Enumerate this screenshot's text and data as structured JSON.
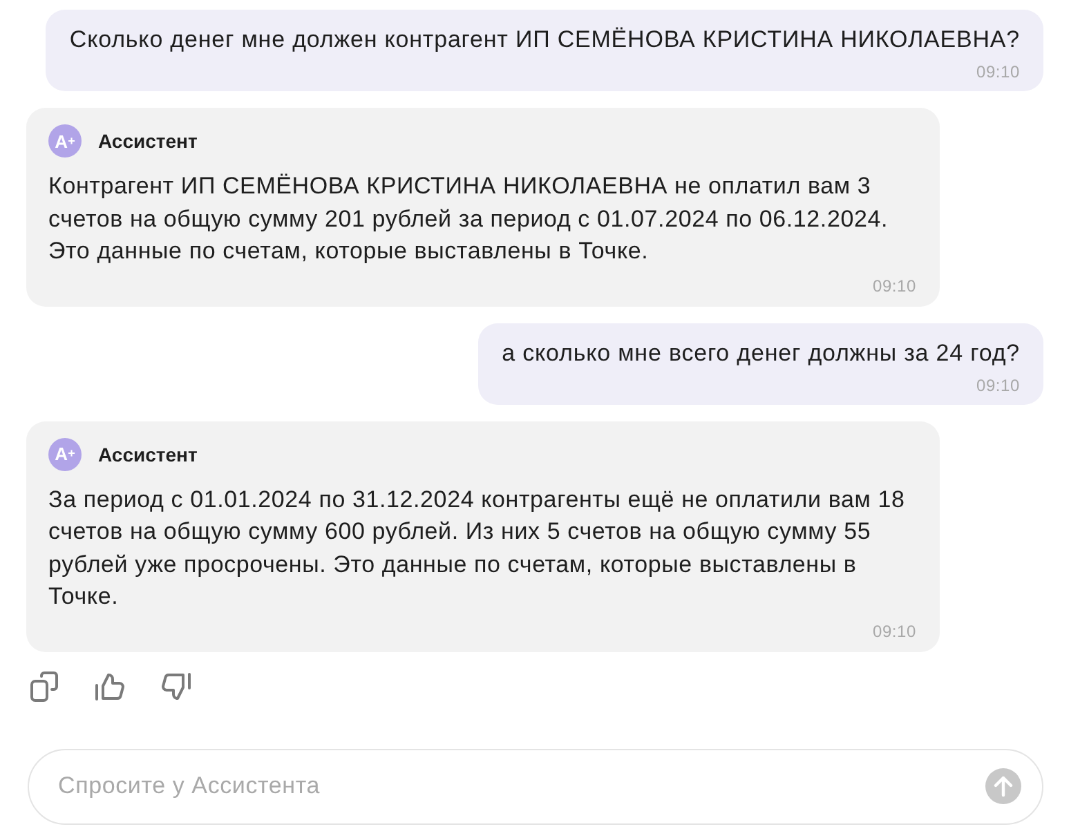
{
  "messages": [
    {
      "kind": "user",
      "text": "Сколько денег мне должен контрагент ИП СЕМЁНОВА КРИСТИНА НИКОЛАЕВНА?",
      "time": "09:10"
    },
    {
      "kind": "assistant",
      "avatar": "A$^{+}$",
      "author": "Ассистент",
      "text": "Контрагент ИП СЕМЁНОВА КРИСТИНА НИКОЛАЕВНА не оплатил вам 3 счетов на общую сумму 201 рублей за период с 01.07.2024 по 06.12.2024. Это данные по счетам, которые выставлены в Точке.",
      "time": "09:10"
    },
    {
      "kind": "user",
      "text": "а сколько мне всего денег должны за 24 год?",
      "time": "09:10"
    },
    {
      "kind": "assistant",
      "avatar": "A$^{+}$",
      "author": "Ассистент",
      "text": "За период с 01.01.2024 по 31.12.2024 контрагенты ещё не оплатили вам 18 счетов на общую сумму 600 рублей. Из них 5 счетов на общую сумму 55 рублей уже просрочены. Это данные по счетам, которые выставлены в Точке.",
      "time": "09:10"
    }
  ],
  "composer": {
    "placeholder": "Спросите у Ассистента"
  }
}
